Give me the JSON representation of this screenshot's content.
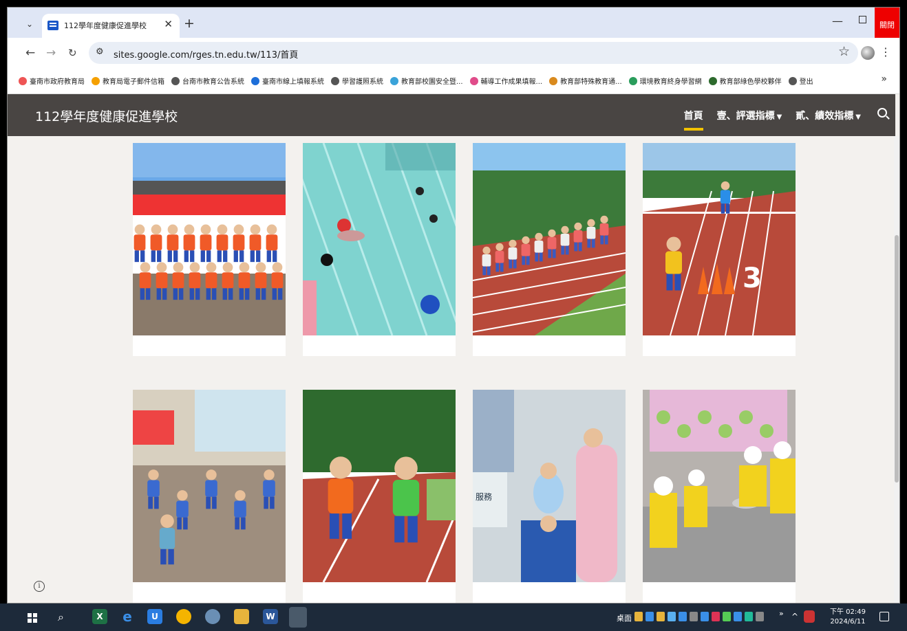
{
  "browser": {
    "tab_title": "112學年度健康促進學校",
    "close_window_label": "關閉",
    "url": "sites.google.com/rges.tn.edu.tw/113/首頁"
  },
  "bookmarks": [
    {
      "label": "臺南市政府教育局",
      "color": "#e55"
    },
    {
      "label": "教育局電子郵件信箱",
      "color": "#f5a000"
    },
    {
      "label": "台南市教育公告系統",
      "color": "#555"
    },
    {
      "label": "臺南市線上填報系統",
      "color": "#1e6fd9"
    },
    {
      "label": "學習護照系統",
      "color": "#555"
    },
    {
      "label": "教育部校園安全暨...",
      "color": "#3aa3d9"
    },
    {
      "label": "輔導工作成果填報...",
      "color": "#e04c8a"
    },
    {
      "label": "教育部特殊教育通...",
      "color": "#d98a1e"
    },
    {
      "label": "環境教育終身學習網",
      "color": "#2a9d5c"
    },
    {
      "label": "教育部綠色學校夥伴",
      "color": "#2d6a2d"
    },
    {
      "label": "登出",
      "color": "#555"
    }
  ],
  "site": {
    "title": "112學年度健康促進學校",
    "nav": [
      {
        "label": "首頁",
        "active": true,
        "dropdown": false
      },
      {
        "label": "壹、評選指標",
        "active": false,
        "dropdown": true
      },
      {
        "label": "貳、績效指標",
        "active": false,
        "dropdown": true
      }
    ]
  },
  "gallery": [
    {
      "name": "baseball-team-photo",
      "scene": "team"
    },
    {
      "name": "swimming-pool-photo",
      "scene": "pool"
    },
    {
      "name": "track-running-photo",
      "scene": "track"
    },
    {
      "name": "track-relay-cones-photo",
      "scene": "cones",
      "lane_number": "3"
    },
    {
      "name": "stretching-class-photo",
      "scene": "gym"
    },
    {
      "name": "relay-race-photo",
      "scene": "relay"
    },
    {
      "name": "dental-checkup-photo",
      "scene": "dental",
      "sign_text": "服務"
    },
    {
      "name": "cooking-class-photo",
      "scene": "kitchen"
    }
  ],
  "taskbar": {
    "desktop_label": "桌面",
    "time": "下午 02:49",
    "date": "2024/6/11"
  }
}
